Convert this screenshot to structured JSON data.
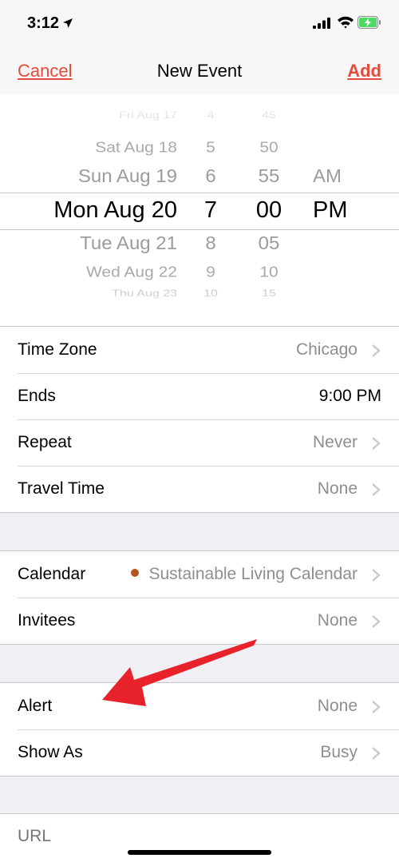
{
  "status_bar": {
    "time": "3:12"
  },
  "nav": {
    "cancel": "Cancel",
    "title": "New Event",
    "add": "Add"
  },
  "picker": {
    "rows": [
      {
        "date": "Fri Aug 17",
        "hour": "4",
        "minute": "45",
        "ampm": ""
      },
      {
        "date": "Sat Aug 18",
        "hour": "5",
        "minute": "50",
        "ampm": ""
      },
      {
        "date": "Sun Aug 19",
        "hour": "6",
        "minute": "55",
        "ampm": "AM"
      },
      {
        "date": "Mon Aug 20",
        "hour": "7",
        "minute": "00",
        "ampm": "PM"
      },
      {
        "date": "Tue Aug 21",
        "hour": "8",
        "minute": "05",
        "ampm": ""
      },
      {
        "date": "Wed Aug 22",
        "hour": "9",
        "minute": "10",
        "ampm": ""
      },
      {
        "date": "Thu Aug 23",
        "hour": "10",
        "minute": "15",
        "ampm": ""
      }
    ]
  },
  "settings": {
    "time_zone": {
      "label": "Time Zone",
      "value": "Chicago"
    },
    "ends": {
      "label": "Ends",
      "value": "9:00 PM"
    },
    "repeat": {
      "label": "Repeat",
      "value": "Never"
    },
    "travel_time": {
      "label": "Travel Time",
      "value": "None"
    },
    "calendar": {
      "label": "Calendar",
      "value": "Sustainable Living Calendar",
      "dot_color": "#b5521f"
    },
    "invitees": {
      "label": "Invitees",
      "value": "None"
    },
    "alert": {
      "label": "Alert",
      "value": "None"
    },
    "show_as": {
      "label": "Show As",
      "value": "Busy"
    }
  },
  "url": {
    "placeholder": "URL"
  },
  "colors": {
    "accent": "#e64c3c",
    "arrow": "#e8222b",
    "secondary_text": "#8e8e93"
  },
  "icons": [
    "location-arrow-icon",
    "cellular-signal-icon",
    "wifi-icon",
    "battery-charging-icon",
    "chevron-right-icon",
    "red-arrow-annotation"
  ]
}
